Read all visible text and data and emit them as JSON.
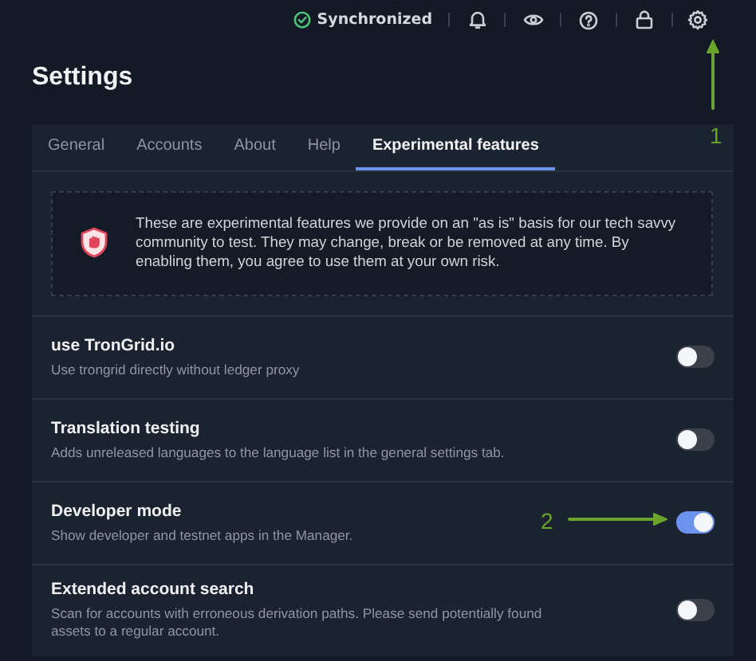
{
  "header": {
    "status": "Synchronized"
  },
  "title": "Settings",
  "tabs": [
    {
      "label": "General",
      "selected": false
    },
    {
      "label": "Accounts",
      "selected": false
    },
    {
      "label": "About",
      "selected": false
    },
    {
      "label": "Help",
      "selected": false
    },
    {
      "label": "Experimental features",
      "selected": true
    }
  ],
  "notice": "These are experimental features we provide on an \"as is\" basis for our tech savvy community to test. They may change, break or be removed at any time. By enabling them, you agree to use them at your own risk.",
  "rows": [
    {
      "title": "use TronGrid.io",
      "description": "Use trongrid directly without ledger proxy",
      "on": false
    },
    {
      "title": "Translation testing",
      "description": "Adds unreleased languages to the language list in the general settings tab.",
      "on": false
    },
    {
      "title": "Developer mode",
      "description": "Show developer and testnet apps in the Manager.",
      "on": true
    },
    {
      "title": "Extended account search",
      "description": "Scan for accounts with erroneous derivation paths. Please send potentially found assets to a regular account.",
      "on": false
    }
  ],
  "annotations": [
    {
      "label": "1"
    },
    {
      "label": "2"
    }
  ]
}
